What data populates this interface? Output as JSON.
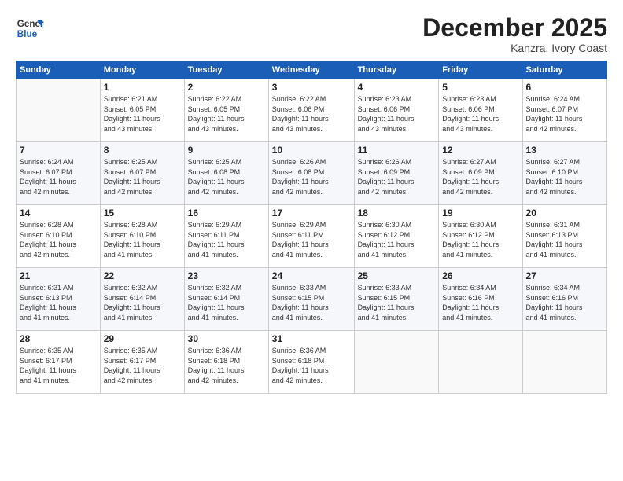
{
  "header": {
    "logo_line1": "General",
    "logo_line2": "Blue",
    "month_title": "December 2025",
    "location": "Kanzra, Ivory Coast"
  },
  "calendar": {
    "days_of_week": [
      "Sunday",
      "Monday",
      "Tuesday",
      "Wednesday",
      "Thursday",
      "Friday",
      "Saturday"
    ],
    "weeks": [
      [
        {
          "day": "",
          "info": ""
        },
        {
          "day": "1",
          "info": "Sunrise: 6:21 AM\nSunset: 6:05 PM\nDaylight: 11 hours\nand 43 minutes."
        },
        {
          "day": "2",
          "info": "Sunrise: 6:22 AM\nSunset: 6:05 PM\nDaylight: 11 hours\nand 43 minutes."
        },
        {
          "day": "3",
          "info": "Sunrise: 6:22 AM\nSunset: 6:06 PM\nDaylight: 11 hours\nand 43 minutes."
        },
        {
          "day": "4",
          "info": "Sunrise: 6:23 AM\nSunset: 6:06 PM\nDaylight: 11 hours\nand 43 minutes."
        },
        {
          "day": "5",
          "info": "Sunrise: 6:23 AM\nSunset: 6:06 PM\nDaylight: 11 hours\nand 43 minutes."
        },
        {
          "day": "6",
          "info": "Sunrise: 6:24 AM\nSunset: 6:07 PM\nDaylight: 11 hours\nand 42 minutes."
        }
      ],
      [
        {
          "day": "7",
          "info": "Sunrise: 6:24 AM\nSunset: 6:07 PM\nDaylight: 11 hours\nand 42 minutes."
        },
        {
          "day": "8",
          "info": "Sunrise: 6:25 AM\nSunset: 6:07 PM\nDaylight: 11 hours\nand 42 minutes."
        },
        {
          "day": "9",
          "info": "Sunrise: 6:25 AM\nSunset: 6:08 PM\nDaylight: 11 hours\nand 42 minutes."
        },
        {
          "day": "10",
          "info": "Sunrise: 6:26 AM\nSunset: 6:08 PM\nDaylight: 11 hours\nand 42 minutes."
        },
        {
          "day": "11",
          "info": "Sunrise: 6:26 AM\nSunset: 6:09 PM\nDaylight: 11 hours\nand 42 minutes."
        },
        {
          "day": "12",
          "info": "Sunrise: 6:27 AM\nSunset: 6:09 PM\nDaylight: 11 hours\nand 42 minutes."
        },
        {
          "day": "13",
          "info": "Sunrise: 6:27 AM\nSunset: 6:10 PM\nDaylight: 11 hours\nand 42 minutes."
        }
      ],
      [
        {
          "day": "14",
          "info": "Sunrise: 6:28 AM\nSunset: 6:10 PM\nDaylight: 11 hours\nand 42 minutes."
        },
        {
          "day": "15",
          "info": "Sunrise: 6:28 AM\nSunset: 6:10 PM\nDaylight: 11 hours\nand 41 minutes."
        },
        {
          "day": "16",
          "info": "Sunrise: 6:29 AM\nSunset: 6:11 PM\nDaylight: 11 hours\nand 41 minutes."
        },
        {
          "day": "17",
          "info": "Sunrise: 6:29 AM\nSunset: 6:11 PM\nDaylight: 11 hours\nand 41 minutes."
        },
        {
          "day": "18",
          "info": "Sunrise: 6:30 AM\nSunset: 6:12 PM\nDaylight: 11 hours\nand 41 minutes."
        },
        {
          "day": "19",
          "info": "Sunrise: 6:30 AM\nSunset: 6:12 PM\nDaylight: 11 hours\nand 41 minutes."
        },
        {
          "day": "20",
          "info": "Sunrise: 6:31 AM\nSunset: 6:13 PM\nDaylight: 11 hours\nand 41 minutes."
        }
      ],
      [
        {
          "day": "21",
          "info": "Sunrise: 6:31 AM\nSunset: 6:13 PM\nDaylight: 11 hours\nand 41 minutes."
        },
        {
          "day": "22",
          "info": "Sunrise: 6:32 AM\nSunset: 6:14 PM\nDaylight: 11 hours\nand 41 minutes."
        },
        {
          "day": "23",
          "info": "Sunrise: 6:32 AM\nSunset: 6:14 PM\nDaylight: 11 hours\nand 41 minutes."
        },
        {
          "day": "24",
          "info": "Sunrise: 6:33 AM\nSunset: 6:15 PM\nDaylight: 11 hours\nand 41 minutes."
        },
        {
          "day": "25",
          "info": "Sunrise: 6:33 AM\nSunset: 6:15 PM\nDaylight: 11 hours\nand 41 minutes."
        },
        {
          "day": "26",
          "info": "Sunrise: 6:34 AM\nSunset: 6:16 PM\nDaylight: 11 hours\nand 41 minutes."
        },
        {
          "day": "27",
          "info": "Sunrise: 6:34 AM\nSunset: 6:16 PM\nDaylight: 11 hours\nand 41 minutes."
        }
      ],
      [
        {
          "day": "28",
          "info": "Sunrise: 6:35 AM\nSunset: 6:17 PM\nDaylight: 11 hours\nand 41 minutes."
        },
        {
          "day": "29",
          "info": "Sunrise: 6:35 AM\nSunset: 6:17 PM\nDaylight: 11 hours\nand 42 minutes."
        },
        {
          "day": "30",
          "info": "Sunrise: 6:36 AM\nSunset: 6:18 PM\nDaylight: 11 hours\nand 42 minutes."
        },
        {
          "day": "31",
          "info": "Sunrise: 6:36 AM\nSunset: 6:18 PM\nDaylight: 11 hours\nand 42 minutes."
        },
        {
          "day": "",
          "info": ""
        },
        {
          "day": "",
          "info": ""
        },
        {
          "day": "",
          "info": ""
        }
      ]
    ]
  }
}
